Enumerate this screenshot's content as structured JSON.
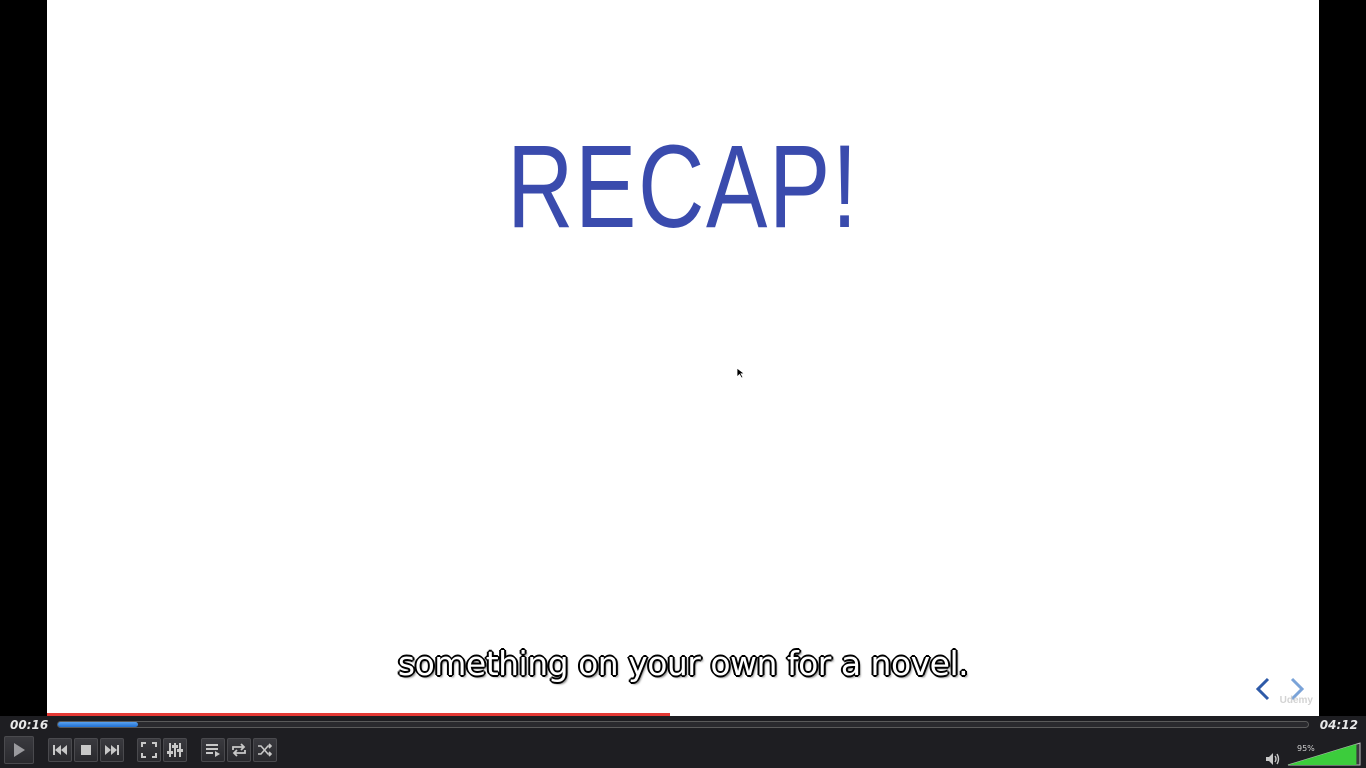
{
  "slide": {
    "title": "RECAP!",
    "watermark": "Udemy"
  },
  "subtitle": "something on your own for a novel.",
  "icons": {
    "slide_prev": "chevron-left-icon",
    "slide_next": "chevron-right-icon",
    "cursor": "mouse-pointer-icon"
  },
  "playback": {
    "elapsed": "00:16",
    "total": "04:12",
    "progress": 0.064,
    "buffered": 0.49
  },
  "controls": {
    "buttons": [
      "play",
      "previous",
      "stop",
      "next",
      "fullscreen",
      "extended-settings",
      "playlist",
      "loop",
      "random"
    ]
  },
  "volume": {
    "percent_label": "95%",
    "level": 0.95
  },
  "colors": {
    "title": "#3a4bad",
    "seek_fill": "#2f80e0",
    "volume_fill": "#3ccc3c",
    "buffer": "#e53935"
  }
}
